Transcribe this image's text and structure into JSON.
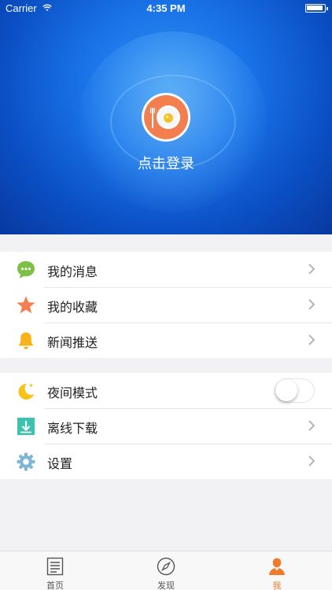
{
  "status_bar": {
    "carrier": "Carrier",
    "time": "4:35 PM"
  },
  "header": {
    "login_text": "点击登录"
  },
  "group1": [
    {
      "label": "我的消息",
      "icon": "message-icon"
    },
    {
      "label": "我的收藏",
      "icon": "star-icon"
    },
    {
      "label": "新闻推送",
      "icon": "bell-icon"
    }
  ],
  "group2": [
    {
      "label": "夜间模式",
      "icon": "moon-icon",
      "toggle_on": false
    },
    {
      "label": "离线下载",
      "icon": "download-icon"
    },
    {
      "label": "设置",
      "icon": "gear-icon"
    }
  ],
  "tabbar": [
    {
      "label": "首页",
      "icon": "document-icon",
      "active": false
    },
    {
      "label": "发现",
      "icon": "compass-icon",
      "active": false
    },
    {
      "label": "我",
      "icon": "person-icon",
      "active": true
    }
  ],
  "colors": {
    "accent": "#f07b2a",
    "header_blue": "#1a73e8"
  }
}
